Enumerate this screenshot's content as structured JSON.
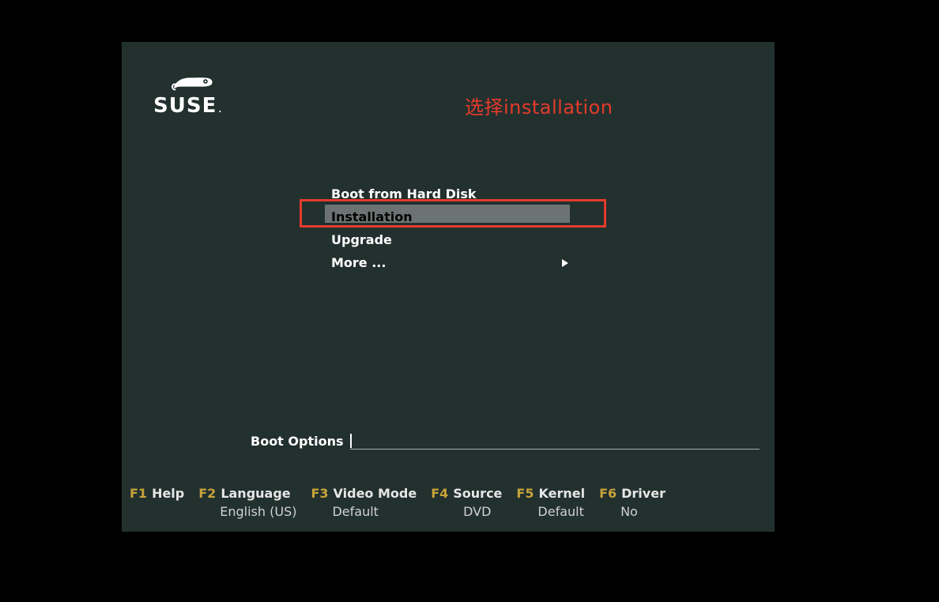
{
  "brand": {
    "word": "SUSE",
    "dot": "."
  },
  "annotation": "选择installation",
  "menu": {
    "items": [
      {
        "label": "Boot from Hard Disk",
        "selected": false,
        "submenu": false
      },
      {
        "label": "Installation",
        "selected": true,
        "submenu": false
      },
      {
        "label": "Upgrade",
        "selected": false,
        "submenu": false
      },
      {
        "label": "More ...",
        "selected": false,
        "submenu": true
      }
    ]
  },
  "boot_options": {
    "label": "Boot Options",
    "value": ""
  },
  "fkeys": [
    {
      "key": "F1",
      "label": "Help",
      "value": ""
    },
    {
      "key": "F2",
      "label": "Language",
      "value": "English (US)"
    },
    {
      "key": "F3",
      "label": "Video Mode",
      "value": "Default"
    },
    {
      "key": "F4",
      "label": "Source",
      "value": "DVD"
    },
    {
      "key": "F5",
      "label": "Kernel",
      "value": "Default"
    },
    {
      "key": "F6",
      "label": "Driver",
      "value": "No"
    }
  ]
}
